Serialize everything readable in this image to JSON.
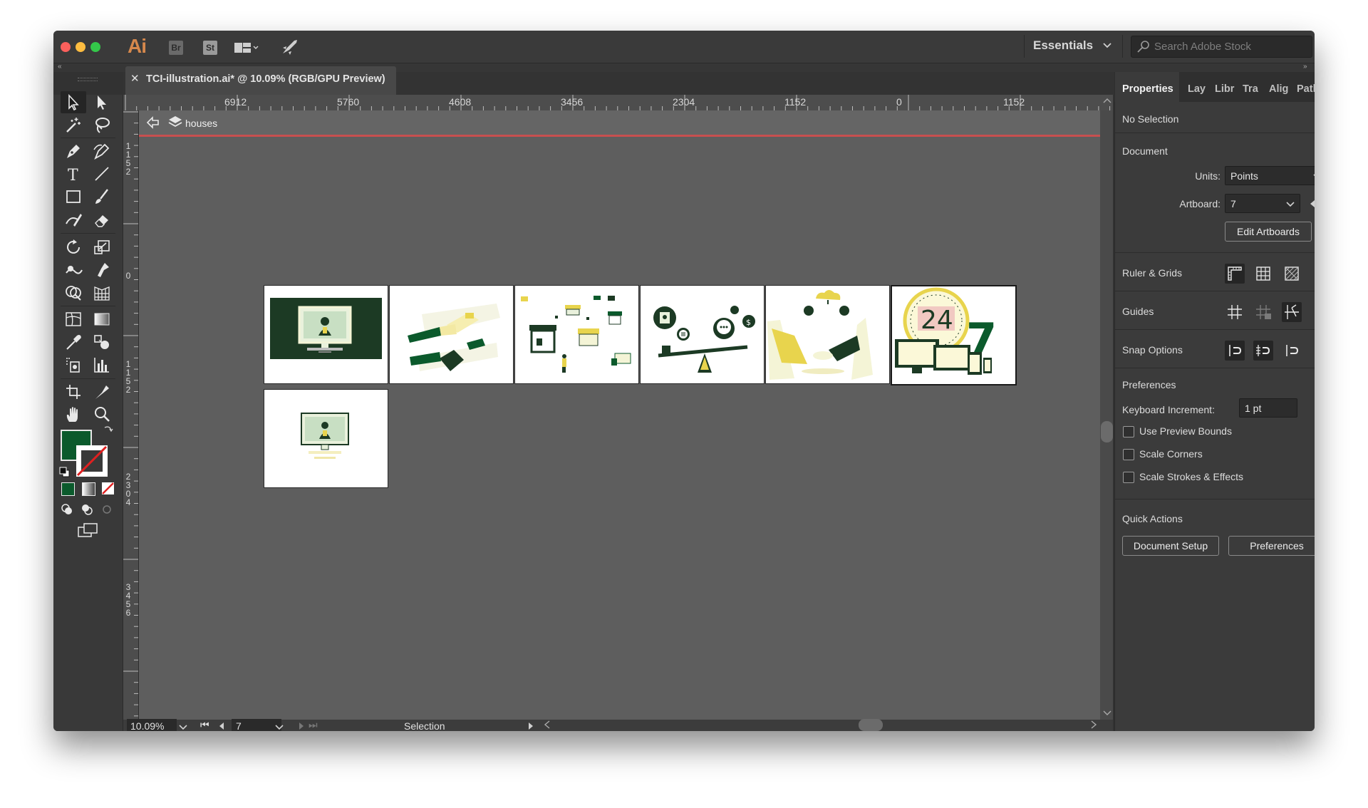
{
  "app": {
    "logo": "Ai",
    "bridge_label": "Br",
    "stock_label": "St",
    "workspace": "Essentials",
    "search_placeholder": "Search Adobe Stock"
  },
  "document": {
    "tab_title": "TCI-illustration.ai* @ 10.09% (RGB/GPU Preview)",
    "isolation_layer": "houses"
  },
  "rulers": {
    "horizontal": [
      "6912",
      "5760",
      "4608",
      "3456",
      "2304",
      "1152",
      "0",
      "1152"
    ],
    "vertical": [
      "1152",
      "0",
      "1152",
      "2304",
      "3456"
    ]
  },
  "status_bar": {
    "zoom": "10.09%",
    "artboard_number": "7",
    "current_tool": "Selection"
  },
  "properties_panel": {
    "tabs": [
      "Properties",
      "Layers",
      "Libraries",
      "Transform",
      "Align",
      "Pathfinder"
    ],
    "tab_labels": [
      "Properties",
      "Lay",
      "Libr",
      "Tra",
      "Alig",
      "Path"
    ],
    "selection_state": "No Selection",
    "document_section": "Document",
    "units_label": "Units:",
    "units_value": "Points",
    "artboard_label": "Artboard:",
    "artboard_value": "7",
    "edit_artboards": "Edit Artboards",
    "ruler_grids": "Ruler & Grids",
    "guides": "Guides",
    "snap_options": "Snap Options",
    "preferences_section": "Preferences",
    "keyboard_increment_label": "Keyboard Increment:",
    "keyboard_increment_value": "1 pt",
    "use_preview_bounds": "Use Preview Bounds",
    "scale_corners": "Scale Corners",
    "scale_strokes_effects": "Scale Strokes & Effects",
    "quick_actions": "Quick Actions",
    "document_setup_button": "Document Setup",
    "preferences_button": "Preferences"
  },
  "artboard_texts": {
    "clock_number": "24",
    "clock_seven": "7"
  },
  "colors": {
    "fill": "#0b5a2c",
    "accent_yellow": "#e8d44d",
    "dark_green": "#1c3a24",
    "cream": "#fbf8d8",
    "isolation_line": "#c74f4f"
  },
  "icons": [
    "selection-tool",
    "direct-selection-tool",
    "magic-wand-tool",
    "lasso-tool",
    "pen-tool",
    "curvature-tool",
    "type-tool",
    "line-tool",
    "rectangle-tool",
    "paintbrush-tool",
    "shaper-tool",
    "eraser-tool",
    "rotate-tool",
    "scale-tool",
    "warp-tool",
    "puppet-warp-tool",
    "shape-builder-tool",
    "perspective-grid-tool",
    "mesh-tool",
    "gradient-tool",
    "eyedropper-tool",
    "blend-tool",
    "symbol-sprayer-tool",
    "column-graph-tool",
    "artboard-tool",
    "slice-tool",
    "hand-tool",
    "zoom-tool"
  ]
}
